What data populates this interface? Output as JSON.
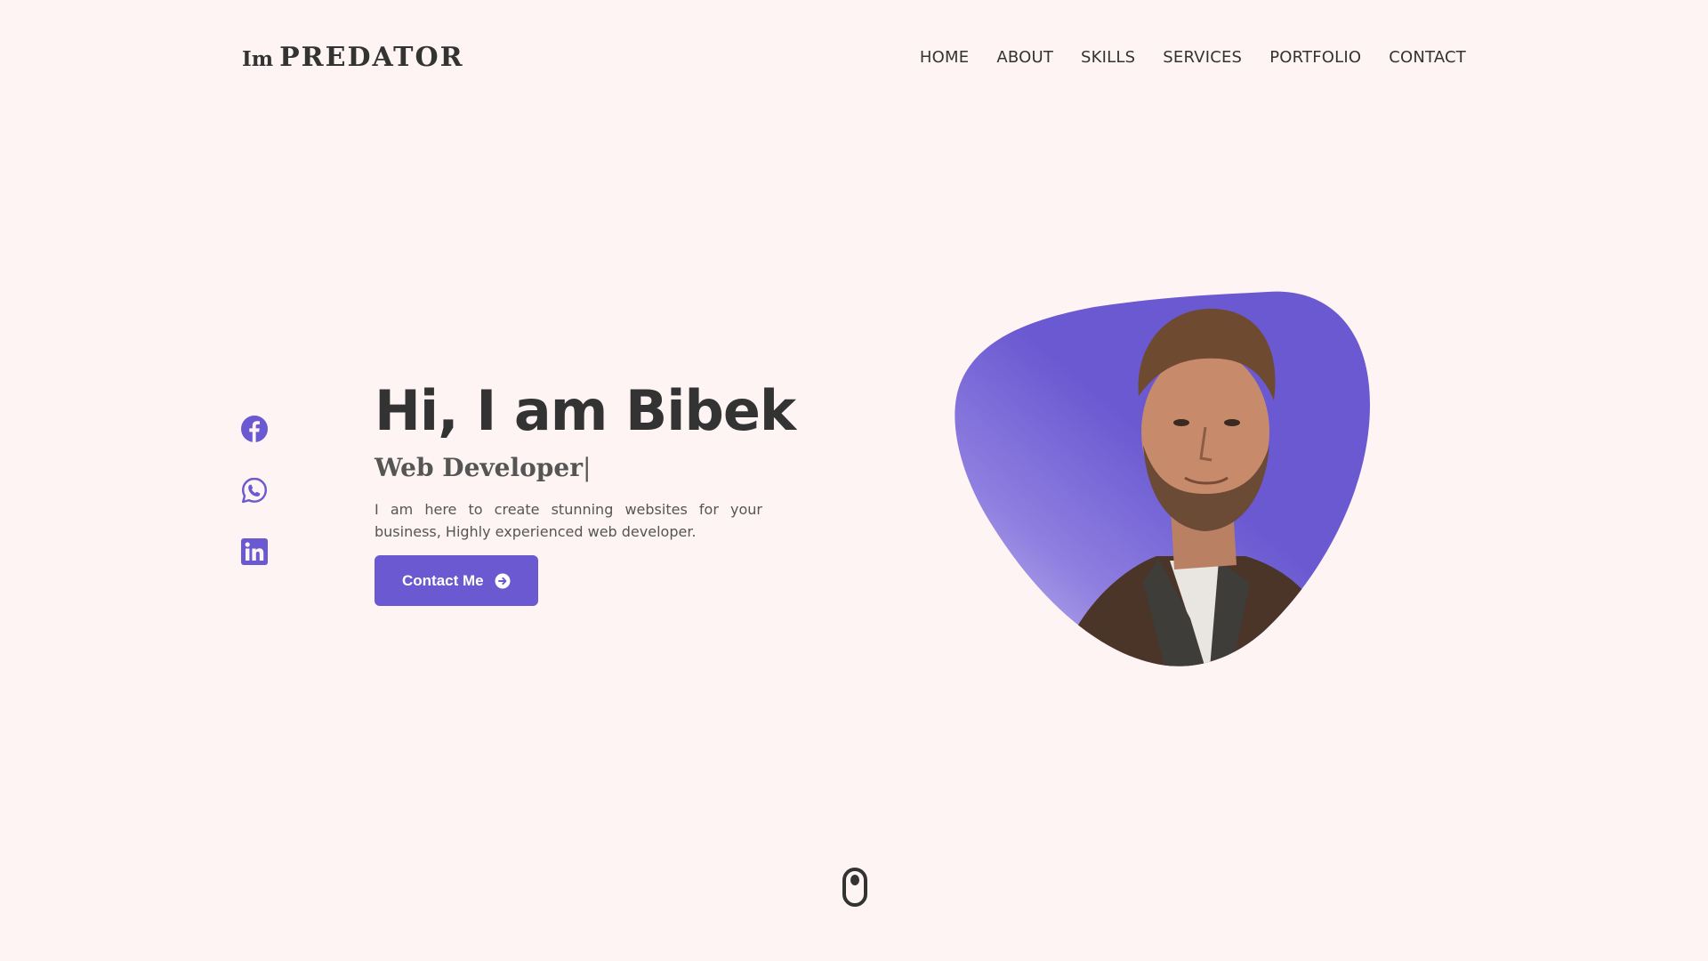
{
  "logo": {
    "prefix": "Im",
    "name": "PREDATOR"
  },
  "nav": {
    "items": [
      "HOME",
      "ABOUT",
      "SKILLS",
      "SERVICES",
      "PORTFOLIO",
      "CONTACT"
    ]
  },
  "social": {
    "icons": [
      "facebook-icon",
      "whatsapp-icon",
      "linkedin-icon"
    ]
  },
  "hero": {
    "title": "Hi, I am Bibek",
    "subtitle": "Web Developer",
    "cursor": "|",
    "description": "I am here to create stunning websites for your business, Highly experienced web developer.",
    "button_label": "Contact Me",
    "button_icon": "arrow-right-circle-icon"
  },
  "hero_image": {
    "description_icon": "profile-photo"
  },
  "scroll_indicator": {
    "icon": "mouse-scroll-icon"
  },
  "colors": {
    "accent": "#6a59d1",
    "background": "#fdf4f3",
    "text": "#333333",
    "muted_text": "#555555"
  }
}
